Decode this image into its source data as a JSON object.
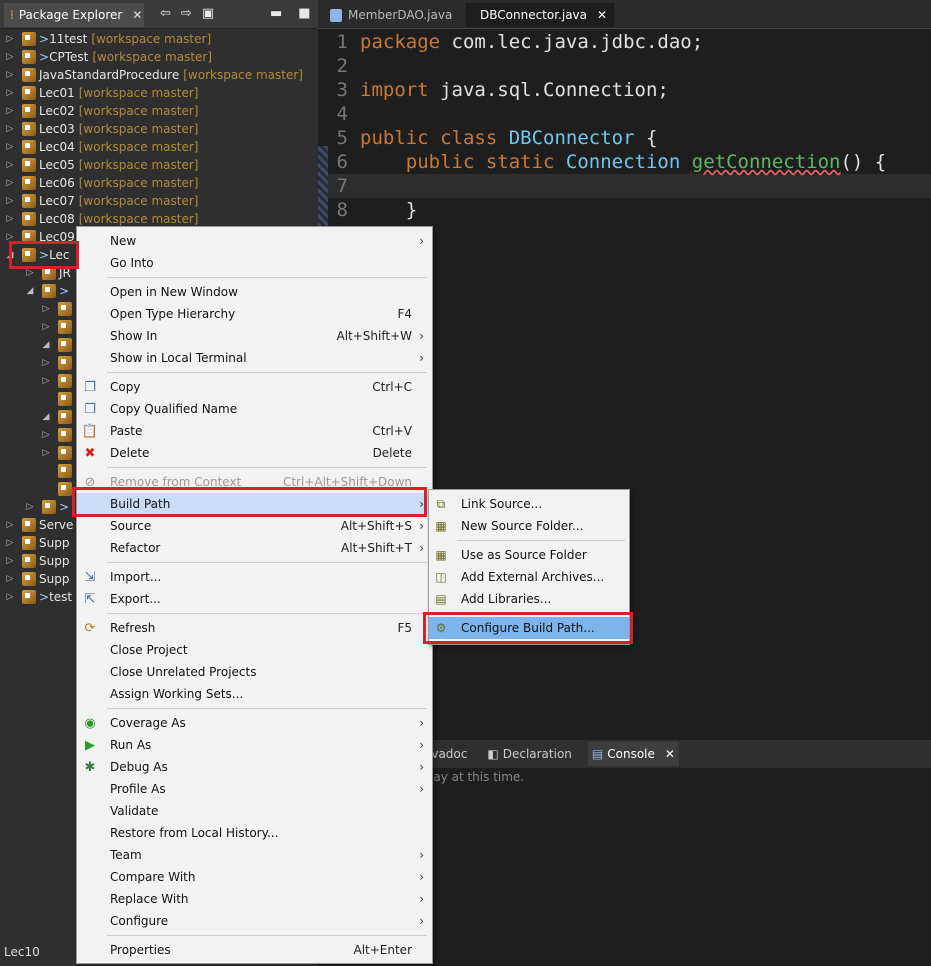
{
  "left_panel": {
    "tab_title": "Package Explorer",
    "tree": [
      {
        "twisty": "▷",
        "dirty": "> ",
        "name": "11test",
        "git": "[workspace master]"
      },
      {
        "twisty": "▷",
        "dirty": "> ",
        "name": "CPTest",
        "git": "[workspace master]"
      },
      {
        "twisty": "▷",
        "dirty": "",
        "name": "JavaStandardProcedure",
        "git": "[workspace master]"
      },
      {
        "twisty": "▷",
        "dirty": "",
        "name": "Lec01",
        "git": "[workspace master]"
      },
      {
        "twisty": "▷",
        "dirty": "",
        "name": "Lec02",
        "git": "[workspace master]"
      },
      {
        "twisty": "▷",
        "dirty": "",
        "name": "Lec03",
        "git": "[workspace master]"
      },
      {
        "twisty": "▷",
        "dirty": "",
        "name": "Lec04",
        "git": "[workspace master]"
      },
      {
        "twisty": "▷",
        "dirty": "",
        "name": "Lec05",
        "git": "[workspace master]"
      },
      {
        "twisty": "▷",
        "dirty": "",
        "name": "Lec06",
        "git": "[workspace master]"
      },
      {
        "twisty": "▷",
        "dirty": "",
        "name": "Lec07",
        "git": "[workspace master]"
      },
      {
        "twisty": "▷",
        "dirty": "",
        "name": "Lec08",
        "git": "[workspace master]"
      },
      {
        "twisty": "▷",
        "dirty": "",
        "name": "Lec09",
        "git": ""
      },
      {
        "twisty": "◢",
        "dirty": "> ",
        "name": "Lec",
        "git": ""
      },
      {
        "twisty": "▷",
        "dirty": "",
        "name": "JR",
        "git": ""
      },
      {
        "twisty": "◢",
        "dirty": "> ",
        "name": "",
        "git": ""
      },
      {
        "twisty": "▷",
        "dirty": "",
        "name": "",
        "git": ""
      },
      {
        "twisty": "▷",
        "dirty": "",
        "name": "",
        "git": ""
      },
      {
        "twisty": "◢",
        "dirty": "",
        "name": "",
        "git": ""
      },
      {
        "twisty": "▷",
        "dirty": "",
        "name": "",
        "git": ""
      },
      {
        "twisty": "▷",
        "dirty": "",
        "name": "",
        "git": ""
      },
      {
        "twisty": "",
        "dirty": "",
        "name": "",
        "git": ""
      },
      {
        "twisty": "◢",
        "dirty": "",
        "name": "",
        "git": ""
      },
      {
        "twisty": "▷",
        "dirty": "",
        "name": "",
        "git": ""
      },
      {
        "twisty": "▷",
        "dirty": "",
        "name": "",
        "git": ""
      },
      {
        "twisty": "",
        "dirty": "",
        "name": "",
        "git": ""
      },
      {
        "twisty": "",
        "dirty": "",
        "name": "",
        "git": ""
      },
      {
        "twisty": "▷",
        "dirty": "> ",
        "name": "",
        "git": ""
      },
      {
        "twisty": "▷",
        "dirty": "",
        "name": "Serve",
        "git": ""
      },
      {
        "twisty": "▷",
        "dirty": "",
        "name": "Supp",
        "git": ""
      },
      {
        "twisty": "▷",
        "dirty": "",
        "name": "Supp",
        "git": ""
      },
      {
        "twisty": "▷",
        "dirty": "",
        "name": "Supp",
        "git": ""
      },
      {
        "twisty": "▷",
        "dirty": "> ",
        "name": "test",
        "git": ""
      }
    ]
  },
  "editor": {
    "tabs": [
      {
        "label": "MemberDAO.java"
      },
      {
        "label": "DBConnector.java"
      }
    ],
    "lines": [
      {
        "n": "1",
        "parts": [
          {
            "t": "package",
            "c": "kw"
          },
          {
            "t": " com.lec.java.jdbc.dao;",
            "c": "txt"
          }
        ]
      },
      {
        "n": "2",
        "parts": []
      },
      {
        "n": "3",
        "parts": [
          {
            "t": "import",
            "c": "kw"
          },
          {
            "t": " java.sql.Connection;",
            "c": "txt"
          }
        ]
      },
      {
        "n": "4",
        "parts": []
      },
      {
        "n": "5",
        "parts": [
          {
            "t": "public class",
            "c": "kw"
          },
          {
            "t": " DBConnector",
            "c": "cls"
          },
          {
            "t": " {",
            "c": "txt"
          }
        ]
      },
      {
        "n": "6",
        "parts": [
          {
            "t": "    public static",
            "c": "kw"
          },
          {
            "t": " Connection",
            "c": "cls"
          },
          {
            "t": " ",
            "c": "txt"
          },
          {
            "t": "getConnection",
            "c": "fn"
          },
          {
            "t": "() {",
            "c": "txt"
          }
        ]
      },
      {
        "n": "7",
        "parts": []
      },
      {
        "n": "8",
        "parts": [
          {
            "t": "    }",
            "c": "txt"
          }
        ]
      }
    ]
  },
  "bottom_tabs": [
    "avadoc",
    "Declaration",
    "Console"
  ],
  "console_text": "lay at this time.",
  "status": "Lec10",
  "context_menu": {
    "items": [
      {
        "label": "New",
        "shortcut": "",
        "arrow": true,
        "icon": ""
      },
      {
        "label": "Go Into",
        "shortcut": "",
        "arrow": false,
        "icon": ""
      },
      {
        "sep": true
      },
      {
        "label": "Open in New Window",
        "shortcut": "",
        "arrow": false,
        "icon": ""
      },
      {
        "label": "Open Type Hierarchy",
        "shortcut": "F4",
        "arrow": false,
        "icon": ""
      },
      {
        "label": "Show In",
        "shortcut": "Alt+Shift+W",
        "arrow": true,
        "icon": ""
      },
      {
        "label": "Show in Local Terminal",
        "shortcut": "",
        "arrow": true,
        "icon": ""
      },
      {
        "sep": true
      },
      {
        "label": "Copy",
        "shortcut": "Ctrl+C",
        "arrow": false,
        "icon": "copy-icon"
      },
      {
        "label": "Copy Qualified Name",
        "shortcut": "",
        "arrow": false,
        "icon": "copy-qualified-icon"
      },
      {
        "label": "Paste",
        "shortcut": "Ctrl+V",
        "arrow": false,
        "icon": "paste-icon"
      },
      {
        "label": "Delete",
        "shortcut": "Delete",
        "arrow": false,
        "icon": "delete-icon"
      },
      {
        "sep": true
      },
      {
        "label": "Remove from Context",
        "shortcut": "Ctrl+Alt+Shift+Down",
        "arrow": false,
        "icon": "remove-context-icon",
        "disabled": true
      },
      {
        "label": "Build Path",
        "shortcut": "",
        "arrow": true,
        "icon": "",
        "selected": true
      },
      {
        "label": "Source",
        "shortcut": "Alt+Shift+S",
        "arrow": true,
        "icon": ""
      },
      {
        "label": "Refactor",
        "shortcut": "Alt+Shift+T",
        "arrow": true,
        "icon": ""
      },
      {
        "sep": true
      },
      {
        "label": "Import...",
        "shortcut": "",
        "arrow": false,
        "icon": "import-icon"
      },
      {
        "label": "Export...",
        "shortcut": "",
        "arrow": false,
        "icon": "export-icon"
      },
      {
        "sep": true
      },
      {
        "label": "Refresh",
        "shortcut": "F5",
        "arrow": false,
        "icon": "refresh-icon"
      },
      {
        "label": "Close Project",
        "shortcut": "",
        "arrow": false,
        "icon": ""
      },
      {
        "label": "Close Unrelated Projects",
        "shortcut": "",
        "arrow": false,
        "icon": ""
      },
      {
        "label": "Assign Working Sets...",
        "shortcut": "",
        "arrow": false,
        "icon": ""
      },
      {
        "sep": true
      },
      {
        "label": "Coverage As",
        "shortcut": "",
        "arrow": true,
        "icon": "coverage-icon"
      },
      {
        "label": "Run As",
        "shortcut": "",
        "arrow": true,
        "icon": "run-icon"
      },
      {
        "label": "Debug As",
        "shortcut": "",
        "arrow": true,
        "icon": "debug-icon"
      },
      {
        "label": "Profile As",
        "shortcut": "",
        "arrow": true,
        "icon": ""
      },
      {
        "label": "Validate",
        "shortcut": "",
        "arrow": false,
        "icon": ""
      },
      {
        "label": "Restore from Local History...",
        "shortcut": "",
        "arrow": false,
        "icon": ""
      },
      {
        "label": "Team",
        "shortcut": "",
        "arrow": true,
        "icon": ""
      },
      {
        "label": "Compare With",
        "shortcut": "",
        "arrow": true,
        "icon": ""
      },
      {
        "label": "Replace With",
        "shortcut": "",
        "arrow": true,
        "icon": ""
      },
      {
        "label": "Configure",
        "shortcut": "",
        "arrow": true,
        "icon": ""
      },
      {
        "sep": true
      },
      {
        "label": "Properties",
        "shortcut": "Alt+Enter",
        "arrow": false,
        "icon": ""
      }
    ]
  },
  "submenu": {
    "items": [
      {
        "label": "Link Source...",
        "icon": "link-source-icon"
      },
      {
        "label": "New Source Folder...",
        "icon": "new-source-folder-icon"
      },
      {
        "sep": true
      },
      {
        "label": "Use as Source Folder",
        "icon": "use-source-folder-icon"
      },
      {
        "label": "Add External Archives...",
        "icon": "add-archive-icon"
      },
      {
        "label": "Add Libraries...",
        "icon": "add-library-icon"
      },
      {
        "sep": true
      },
      {
        "label": "Configure Build Path...",
        "icon": "configure-build-path-icon",
        "selected": true
      }
    ]
  }
}
